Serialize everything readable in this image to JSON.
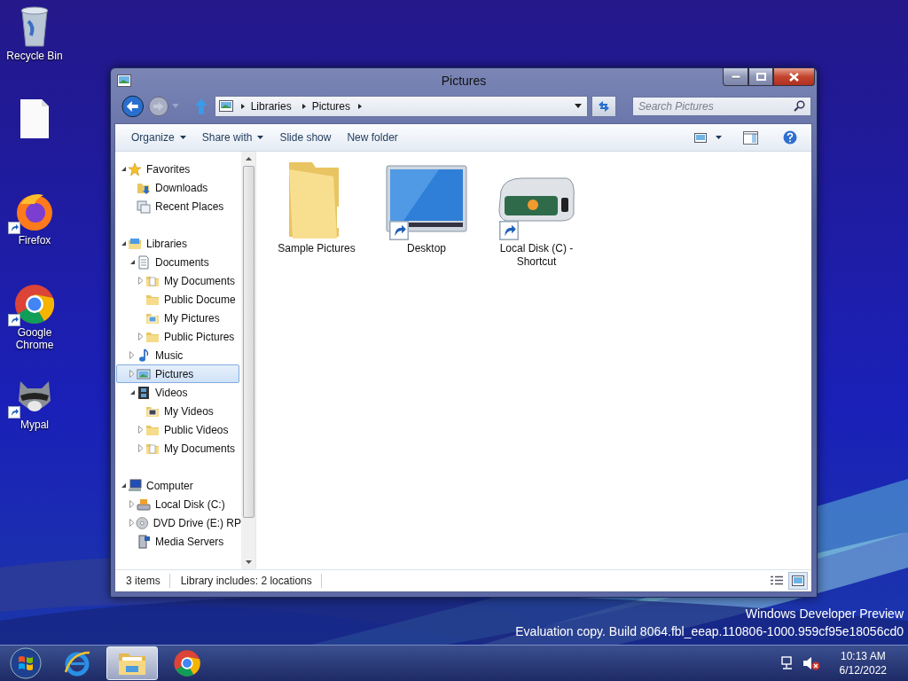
{
  "desktop_icons": [
    {
      "kind": "recycle",
      "label": "Recycle Bin",
      "shortcut": false
    },
    {
      "kind": "file",
      "shortcut": false
    },
    {
      "kind": "firefox",
      "label": "Firefox",
      "shortcut": true
    },
    {
      "kind": "chrome",
      "label": "Google Chrome",
      "shortcut": true
    },
    {
      "kind": "mypal",
      "label": "Mypal",
      "shortcut": true
    }
  ],
  "window": {
    "title": "Pictures",
    "address": {
      "segments": [
        "Libraries",
        "Pictures"
      ]
    },
    "search": {
      "placeholder": "Search Pictures"
    },
    "toolbar": [
      {
        "label": "Organize",
        "dropdown": true
      },
      {
        "label": "Share with",
        "dropdown": true
      },
      {
        "label": "Slide show",
        "dropdown": false
      },
      {
        "label": "New folder",
        "dropdown": false
      }
    ],
    "nav": [
      {
        "label": "Favorites",
        "kind": "star",
        "expanded": true,
        "children": [
          {
            "label": "Downloads",
            "kind": "downloads"
          },
          {
            "label": "Recent Places",
            "kind": "recent"
          }
        ]
      },
      {
        "label": "Libraries",
        "kind": "library",
        "expanded": true,
        "children": [
          {
            "label": "Documents",
            "kind": "documents",
            "expanded": true,
            "children": [
              {
                "label": "My Documents",
                "kind": "docfolder",
                "expanded": false
              },
              {
                "label": "Public Docume",
                "kind": "folder"
              },
              {
                "label": "My Pictures",
                "kind": "picfolder"
              },
              {
                "label": "Public Pictures",
                "kind": "folder",
                "expanded": false
              }
            ]
          },
          {
            "label": "Music",
            "kind": "music",
            "expanded": false
          },
          {
            "label": "Pictures",
            "kind": "pictures",
            "expanded": false,
            "selected": true
          },
          {
            "label": "Videos",
            "kind": "videos",
            "expanded": true,
            "children": [
              {
                "label": "My Videos",
                "kind": "vidfolder"
              },
              {
                "label": "Public Videos",
                "kind": "folder",
                "expanded": false
              },
              {
                "label": "My Documents",
                "kind": "docfolder",
                "expanded": false
              }
            ]
          }
        ]
      },
      {
        "label": "Computer",
        "kind": "computer",
        "expanded": true,
        "children": [
          {
            "label": "Local Disk (C:)",
            "kind": "disk",
            "expanded": false
          },
          {
            "label": "DVD Drive (E:) RP",
            "kind": "dvd",
            "expanded": false
          },
          {
            "label": "Media Servers",
            "kind": "server"
          }
        ]
      }
    ],
    "items": [
      {
        "kind": "folder",
        "label": "Sample Pictures",
        "shortcut": false
      },
      {
        "kind": "desktop",
        "label": "Desktop",
        "shortcut": true
      },
      {
        "kind": "drive",
        "label": "Local Disk (C) - Shortcut",
        "shortcut": true
      }
    ],
    "status": [
      "3 items",
      "Library includes: 2 locations"
    ],
    "views": [
      {
        "kind": "details",
        "selected": false
      },
      {
        "kind": "large",
        "selected": true
      }
    ]
  },
  "watermark": [
    "Windows Developer Preview",
    "Evaluation copy. Build 8064.fbl_eeap.110806-1000.959cf95e18056cd0"
  ],
  "taskbar": {
    "apps": [
      {
        "kind": "ie",
        "selected": false
      },
      {
        "kind": "explorer",
        "selected": true
      },
      {
        "kind": "chrome",
        "selected": false
      }
    ],
    "time": "10:13 AM",
    "date": "6/12/2022"
  }
}
